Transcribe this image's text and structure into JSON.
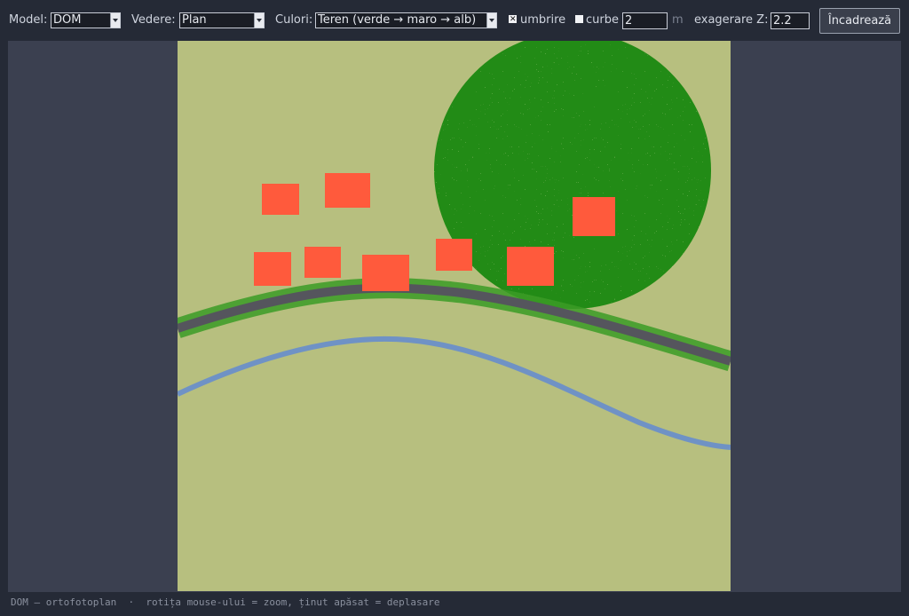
{
  "toolbar": {
    "model_label": "Model:",
    "model_value": "DOM",
    "view_label": "Vedere:",
    "view_value": "Plan",
    "colors_label": "Culori:",
    "colors_value": "Teren (verde → maro → alb)",
    "shading_label": "umbrire",
    "shading_checked": true,
    "shading_mark": "✕",
    "contours_label": "curbe",
    "contours_checked": false,
    "contour_interval": "2",
    "contour_unit": "m",
    "zexag_label": "exagerare Z:",
    "zexag_value": "2.2",
    "fit_button": "Încadrează"
  },
  "map_colors": {
    "ground": "#b7bf7f",
    "forest": "#228b12",
    "buildings": "#ff5a3c",
    "road": "#55555d",
    "road_verge": "#3b9b26",
    "river": "#6f92c5"
  },
  "status": {
    "text": "DOM — ortofotoplan  ·  rotița mouse-ului = zoom, ținut apăsat = deplasare"
  }
}
